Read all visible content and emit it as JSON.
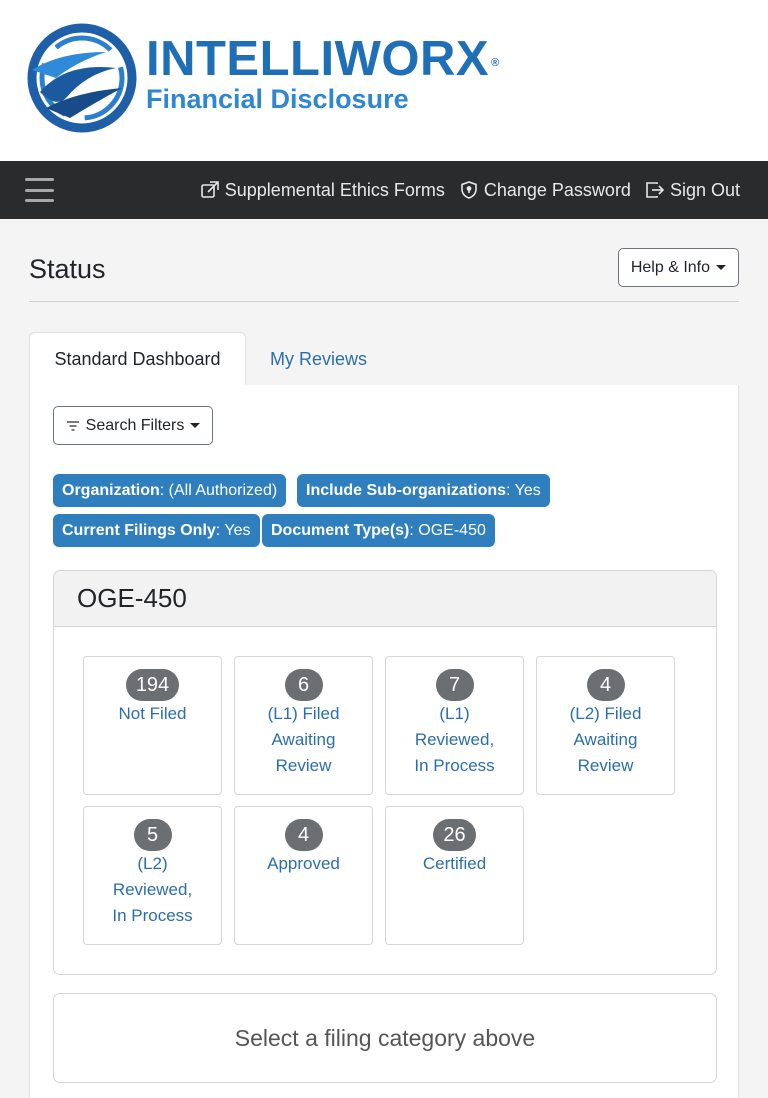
{
  "brand": {
    "name": "INTELLIWORX",
    "registered": "®",
    "subtitle": "Financial Disclosure",
    "primary_color": "#1f6fb7"
  },
  "nav": {
    "menu_icon": "hamburger-icon",
    "links": [
      {
        "label": "Supplemental Ethics Forms",
        "icon": "external-link-icon"
      },
      {
        "label": "Change Password",
        "icon": "shield-icon"
      },
      {
        "label": "Sign Out",
        "icon": "sign-out-icon"
      }
    ]
  },
  "page": {
    "title": "Status",
    "help_button": "Help & Info"
  },
  "tabs": [
    {
      "label": "Standard Dashboard",
      "active": true
    },
    {
      "label": "My Reviews",
      "active": false
    }
  ],
  "filters": {
    "button_label": "Search Filters",
    "chips": [
      {
        "key": "Organization",
        "value": ": (All Authorized)"
      },
      {
        "key": "Include Sub-organizations",
        "value": ": Yes"
      },
      {
        "key": "Current Filings Only",
        "value": ": Yes"
      },
      {
        "key": "Document Type(s)",
        "value": ": OGE-450"
      }
    ],
    "chip_color": "#2f7fbf"
  },
  "card": {
    "title": "OGE-450",
    "tiles": [
      {
        "count": "194",
        "lines": [
          "Not Filed"
        ]
      },
      {
        "count": "6",
        "lines": [
          "(L1) Filed",
          "Awaiting",
          "Review"
        ]
      },
      {
        "count": "7",
        "lines": [
          "(L1)",
          "Reviewed,",
          "In Process"
        ]
      },
      {
        "count": "4",
        "lines": [
          "(L2) Filed",
          "Awaiting",
          "Review"
        ]
      },
      {
        "count": "5",
        "lines": [
          "(L2)",
          "Reviewed,",
          "In Process"
        ]
      },
      {
        "count": "4",
        "lines": [
          "Approved"
        ]
      },
      {
        "count": "26",
        "lines": [
          "Certified"
        ]
      }
    ]
  },
  "placeholder": "Select a filing category above"
}
